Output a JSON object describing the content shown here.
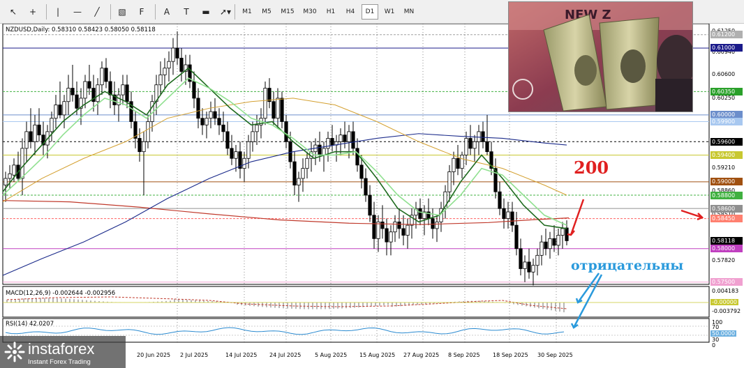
{
  "toolbar": {
    "draw_tools": [
      {
        "name": "cursor-tool",
        "glyph": "↖"
      },
      {
        "name": "crosshair-tool",
        "glyph": "+"
      },
      {
        "name": "vertical-line-tool",
        "glyph": "|"
      },
      {
        "name": "horizontal-line-tool",
        "glyph": "—"
      },
      {
        "name": "trendline-tool",
        "glyph": "╱"
      },
      {
        "name": "channel-tool",
        "glyph": "▧"
      },
      {
        "name": "fibonacci-tool",
        "glyph": "F"
      },
      {
        "name": "text-tool",
        "glyph": "A"
      },
      {
        "name": "text-label-tool",
        "glyph": "T"
      },
      {
        "name": "rectangle-tool",
        "glyph": "▬"
      },
      {
        "name": "arrows-tool",
        "glyph": "➚▾"
      }
    ],
    "timeframes": [
      "M1",
      "M5",
      "M15",
      "M30",
      "H1",
      "H4",
      "D1",
      "W1",
      "MN"
    ],
    "active_timeframe": "D1"
  },
  "chart": {
    "ohlc_text": "NZDUSD,Daily: 0.58310 0.58423 0.58050 0.58118",
    "macd_label": "MACD(12,26,9) -0.002644 -0.002956",
    "rsi_label": "RSI(14) 42.0207",
    "price_axis_ticks": [
      "0.61250",
      "0.60940",
      "0.60600",
      "0.60250",
      "0.59210",
      "0.58860",
      "0.58510",
      "0.57820"
    ],
    "price_labels": [
      {
        "text": "0.61200",
        "bg": "#b0b0b0",
        "fg": "#ffffff"
      },
      {
        "text": "0.61000",
        "bg": "#1a1a8a",
        "fg": "#ffffff"
      },
      {
        "text": "0.60350",
        "bg": "#2aa02a",
        "fg": "#ffffff"
      },
      {
        "text": "0.60000",
        "bg": "#6c8ecb",
        "fg": "#ffffff"
      },
      {
        "text": "0.59900",
        "bg": "#a8c8f0",
        "fg": "#ffffff"
      },
      {
        "text": "0.59600",
        "bg": "#000000",
        "fg": "#ffffff"
      },
      {
        "text": "0.59400",
        "bg": "#c8c830",
        "fg": "#ffffff"
      },
      {
        "text": "0.59000",
        "bg": "#a05010",
        "fg": "#ffffff"
      },
      {
        "text": "0.58800",
        "bg": "#40b040",
        "fg": "#ffffff"
      },
      {
        "text": "0.58600",
        "bg": "#909090",
        "fg": "#ffffff"
      },
      {
        "text": "0.58450",
        "bg": "#ff8070",
        "fg": "#ffffff"
      },
      {
        "text": "0.58118",
        "bg": "#000000",
        "fg": "#ffffff"
      },
      {
        "text": "0.58000",
        "bg": "#c040c0",
        "fg": "#ffffff"
      },
      {
        "text": "0.57500",
        "bg": "#f0a0d0",
        "fg": "#ffffff"
      }
    ],
    "macd_axis": [
      "0.004183",
      "-0.00000",
      "-0.003792"
    ],
    "rsi_axis": [
      "100",
      "70",
      "50.0000",
      "30",
      "0"
    ],
    "dates": [
      "20 Jun 2025",
      "2 Jul 2025",
      "14 Jul 2025",
      "24 Jul 2025",
      "5 Aug 2025",
      "15 Aug 2025",
      "27 Aug 2025",
      "8 Sep 2025",
      "18 Sep 2025",
      "30 Sep 2025"
    ]
  },
  "annotations": {
    "ma_period": "200",
    "negative_text": "отрицательны",
    "arrow_color": "#e02020",
    "blue_color": "#2a9adc"
  },
  "photo": {
    "banner_text": "NEW Z"
  },
  "logo": {
    "brand": "instaforex",
    "tagline": "Instant Forex Trading"
  }
}
